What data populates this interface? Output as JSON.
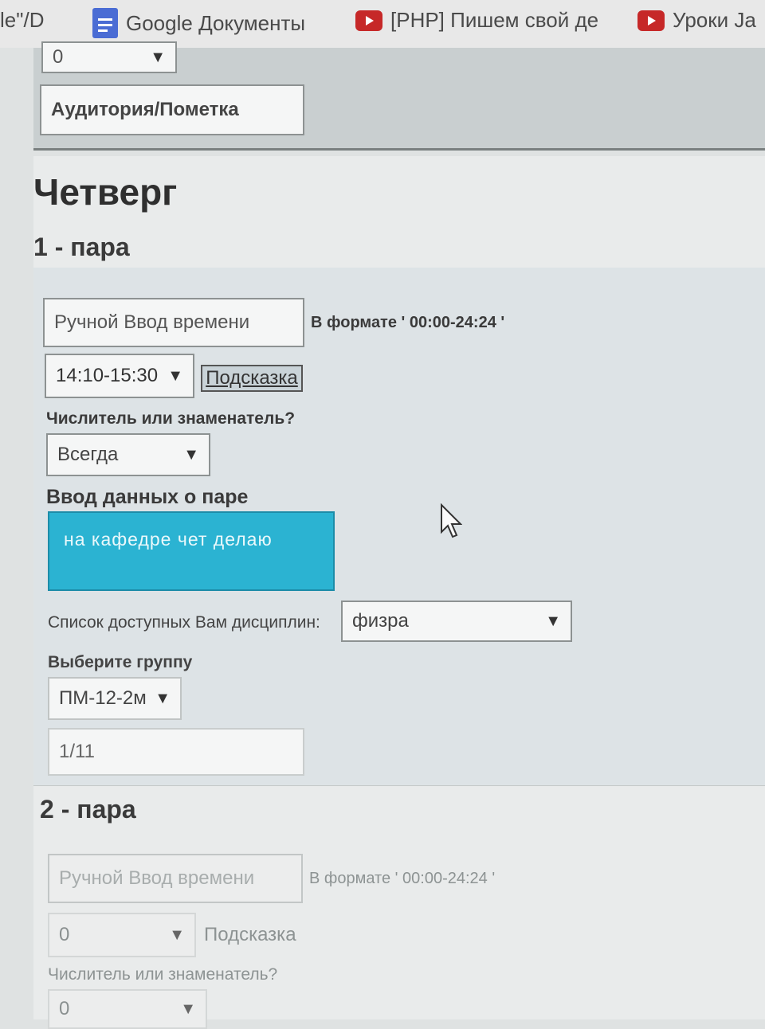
{
  "bookmarks": [
    {
      "label": "le\"/D",
      "icon": "none"
    },
    {
      "label": "Google Документы",
      "icon": "google-docs-icon"
    },
    {
      "label": "[PHP] Пишем свой де",
      "icon": "youtube-icon"
    },
    {
      "label": "Уроки Ja",
      "icon": "youtube-icon"
    }
  ],
  "previous_day": {
    "select_value": "0",
    "room_placeholder": "Аудитория/Пометка"
  },
  "day": {
    "title": "Четверг",
    "pairs": [
      {
        "title": "1 - пара",
        "time_input_placeholder": "Ручной Ввод времени",
        "time_format_hint": "В формате ' 00:00-24:24 '",
        "time_select_value": "14:10-15:30",
        "hint_button": "Подсказка",
        "week_type_label": "Числитель или знаменатель?",
        "week_type_value": "Всегда",
        "pair_data_label": "Ввод данных о паре",
        "pair_data_value": "на кафедре чет делаю",
        "disciplines_label": "Список доступных Вам дисциплин:",
        "discipline_value": "физра",
        "group_label": "Выберите группу",
        "group_value": "ПМ-12-2м",
        "room_value": "1/11"
      },
      {
        "title": "2 - пара",
        "time_input_placeholder": "Ручной Ввод времени",
        "time_format_hint": "В формате ' 00:00-24:24 '",
        "time_select_value": "0",
        "hint_button": "Подсказка",
        "week_type_label": "Числитель или знаменатель?",
        "week_type_value": "0"
      }
    ]
  },
  "colors": {
    "accent_textarea": "#2bb3d2",
    "page_bg": "#e9ebeb",
    "panel_bg": "#dde3e6"
  }
}
